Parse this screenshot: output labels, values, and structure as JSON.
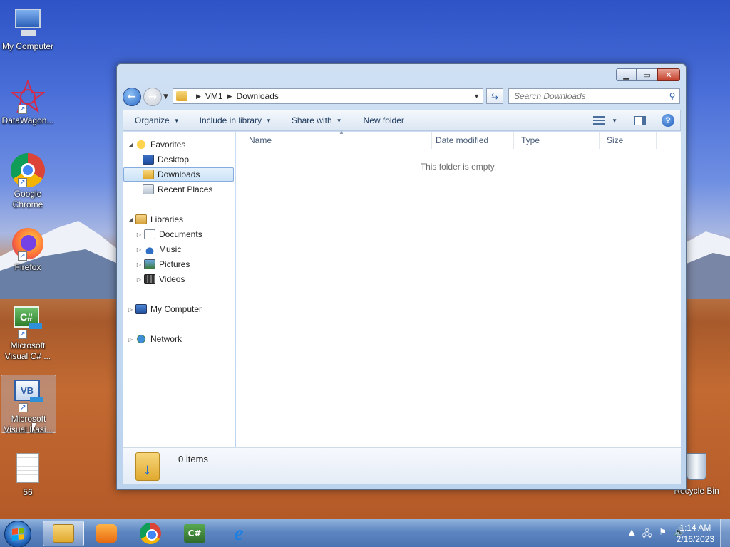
{
  "desktop": {
    "icons": [
      {
        "label": "My Computer"
      },
      {
        "label": "DataWagon..."
      },
      {
        "label": "Google Chrome"
      },
      {
        "label": "Firefox"
      },
      {
        "label": "Microsoft Visual C# ..."
      },
      {
        "label": "Microsoft Visual Basi..."
      },
      {
        "label": "56"
      },
      {
        "label": "Recycle Bin"
      }
    ],
    "vb_icon_text": "VB",
    "cs_icon_text": "C#"
  },
  "window": {
    "breadcrumb": [
      "VM1",
      "Downloads"
    ],
    "search_placeholder": "Search Downloads",
    "toolbar": {
      "organize": "Organize",
      "include_in_library": "Include in library",
      "share_with": "Share with",
      "new_folder": "New folder"
    },
    "nav": {
      "favorites": "Favorites",
      "desktop": "Desktop",
      "downloads": "Downloads",
      "recent_places": "Recent Places",
      "libraries": "Libraries",
      "documents": "Documents",
      "music": "Music",
      "pictures": "Pictures",
      "videos": "Videos",
      "my_computer": "My Computer",
      "network": "Network"
    },
    "columns": [
      "Name",
      "Date modified",
      "Type",
      "Size"
    ],
    "empty_message": "This folder is empty.",
    "details_count": "0 items"
  },
  "taskbar": {
    "time": "1:14 AM",
    "date": "2/16/2023",
    "cs_label": "C#"
  },
  "colors": {
    "accent": "#2e6bc7",
    "selection_border": "#84acdd"
  }
}
